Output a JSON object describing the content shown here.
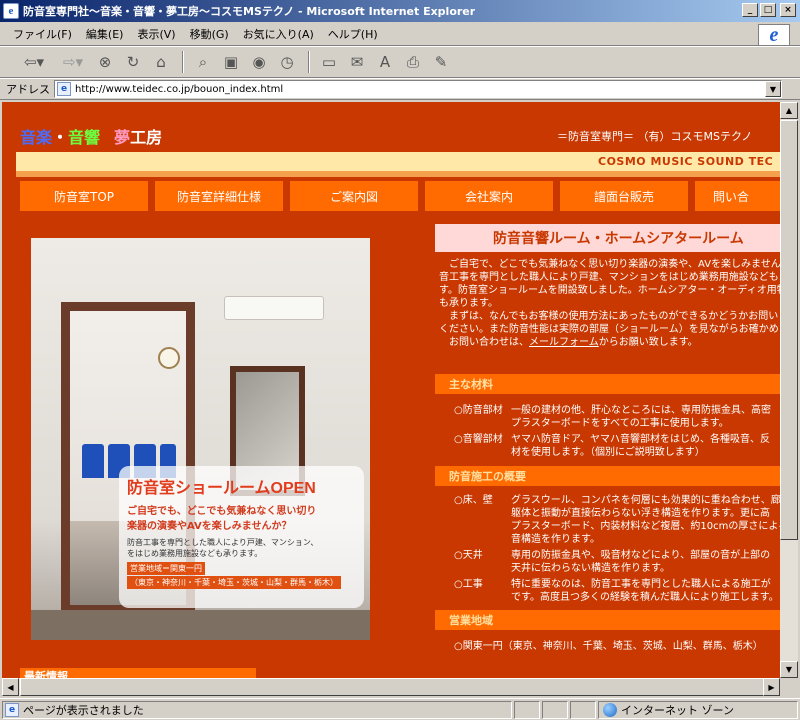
{
  "window": {
    "title": "防音室専門社～音楽・音響・夢工房～コスモMSテクノ - Microsoft Internet Explorer",
    "min": "_",
    "max": "□",
    "close": "×"
  },
  "menu": [
    "ファイル(F)",
    "編集(E)",
    "表示(V)",
    "移動(G)",
    "お気に入り(A)",
    "ヘルプ(H)"
  ],
  "address": {
    "label": "アドレス",
    "url": "http://www.teidec.co.jp/bouon_index.html"
  },
  "site": {
    "logo": {
      "w1": "音楽",
      "w2": "・",
      "w3": "音響",
      "w4": "夢",
      "w5": "工房"
    },
    "header_right": "＝防音室専門＝ （有）コスモMSテクノ",
    "tagline": "COSMO MUSIC SOUND TEC",
    "nav": [
      "防音室TOP",
      "防音室詳細仕様",
      "ご案内図",
      "会社案内",
      "譜面台販売",
      "問い合"
    ],
    "photo_overlay": {
      "title": "防音室ショールームOPEN",
      "body1": "ご自宅でも、どこでも気兼ねなく思い切り",
      "body2": "楽器の演奏やAVを楽しみませんか？",
      "small1": "防音工事を専門とした職人により戸建、マンション、",
      "small2": "をはじめ業務用施設なども承ります。",
      "area1": "営業地域＝関東一円",
      "area2": "（東京・神奈川・千葉・埼玉・茨城・山梨・群馬・栃木）"
    },
    "news_head": "最新情報",
    "main_title": "防音音響ルーム・ホームシアタールーム",
    "intro": [
      "　ご自宅で、どこでも気兼ねなく思い切り楽器の演奏や、AVを楽しみません",
      "音工事を専門とした職人により戸建、マンションをはじめ業務用施設なども",
      "す。防音室ショールームを開設致しました。ホームシアター・オーディオ用特",
      "も承ります。",
      "　まずは、なんでもお客様の使用方法にあったものができるかどうかお問い",
      "ください。また防音性能は実際の部屋（ショールーム）を見ながらお確かめ",
      "　お問い合わせは、"
    ],
    "intro_link": "メールフォーム",
    "intro_tail": "からお願い致します。",
    "sections": {
      "materials": {
        "head": "主な材料",
        "rows": [
          {
            "label": "○防音部材",
            "lines": [
              "一般の建材の他、肝心なところには、専用防振金具、高密",
              "プラスターボードをすべての工事に使用します。"
            ]
          },
          {
            "label": "○音響部材",
            "lines": [
              "ヤマハ防音ドア、ヤマハ音響部材をはじめ、各種吸音、反",
              "材を使用します。（個別にご説明致します）"
            ]
          }
        ]
      },
      "construction": {
        "head": "防音施工の概要",
        "rows": [
          {
            "label": "○床、壁",
            "lines": [
              "グラスウール、コンパネを何層にも効果的に重ね合わせ、廊",
              "躯体と振動が直接伝わらない浮き構造を作ります。更に高",
              "プラスターボード、内装材料など複層、約10cmの厚さによる",
              "音構造を作ります。"
            ]
          },
          {
            "label": "○天井",
            "lines": [
              "専用の防振金具や、吸音材などにより、部屋の音が上部の",
              "天井に伝わらない構造を作ります。"
            ]
          },
          {
            "label": "○工事",
            "lines": [
              "特に重要なのは、防音工事を専門とした職人による施工が",
              "です。高度且つ多くの経験を積んだ職人により施工します。"
            ]
          }
        ]
      },
      "area": {
        "head": "営業地域",
        "rows": [
          {
            "label": "○関東一円（東京、神奈川、千葉、埼玉、茨城、山梨、群馬、栃木）",
            "lines": []
          }
        ]
      }
    }
  },
  "status": {
    "text": "ページが表示されました",
    "zone": "インターネット ゾーン"
  },
  "colors": {
    "page_bg": "#c83800",
    "nav_orange": "#ff6b00",
    "band": "#ffe8a8"
  }
}
